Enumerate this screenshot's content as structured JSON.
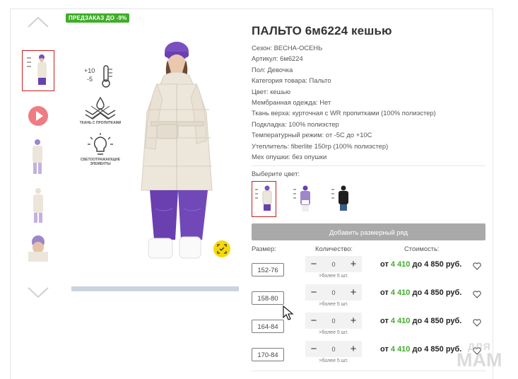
{
  "badge": "ПРЕДЗАКАЗ ДО -9%",
  "product": {
    "title": "ПАЛЬТО 6м6224 кешью",
    "properties": [
      "Сезон: ВЕСНА-ОСЕНЬ",
      "Артикул: 6м6224",
      "Пол: Девочка",
      "Категория товара: Пальто",
      "Цвет: кешью",
      "Мембранная одежда: Нет",
      "Ткань верха: курточная с WR пропитками (100% полиэстер)",
      "Подкладка: 100% полиэстер",
      "Температурный режим: от -5С до +10С",
      "Утеплитель: fiberlite 150гр (100% полиэстер)",
      "Мех опушки: без опушки"
    ]
  },
  "features": {
    "temp_top": "+10",
    "temp_bottom": "-5",
    "fabric_caption": "ТКАНЬ С ПРОПИТКАМИ",
    "reflect_caption": "СВЕТООТРАЖАЮЩИЕ ЭЛЕМЕНТЫ"
  },
  "colors": {
    "label": "Выберите цвет:",
    "swatches": [
      {
        "name": "кешью",
        "coat": "#ece5da",
        "pants": "#6a3fb0"
      },
      {
        "name": "лаванда",
        "coat": "#9d86c9",
        "pants": "#ffffff"
      },
      {
        "name": "черный",
        "coat": "#1e1e1e",
        "pants": "#3b5b8a"
      }
    ]
  },
  "add_size_button": "Добавить размерный ряд",
  "table": {
    "size_header": "Размер:",
    "qty_header": "Количество:",
    "price_header": "Стоимость:",
    "rows": [
      {
        "size": "152-76",
        "qty": "0",
        "note": ">более 5 шт.",
        "price_prefix": "от ",
        "price_from": "4 410",
        "price_suffix": " до 4 850 руб."
      },
      {
        "size": "158-80",
        "qty": "0",
        "note": ">более 5 шт.",
        "price_prefix": "от ",
        "price_from": "4 410",
        "price_suffix": " до 4 850 руб."
      },
      {
        "size": "164-84",
        "qty": "0",
        "note": ">более 5 шт.",
        "price_prefix": "от ",
        "price_from": "4 410",
        "price_suffix": " до 4 850 руб."
      },
      {
        "size": "170-84",
        "qty": "0",
        "note": ">более 5 шт.",
        "price_prefix": "от ",
        "price_from": "4 410",
        "price_suffix": " до 4 850 руб."
      }
    ]
  },
  "qty_minus": "−",
  "qty_plus": "+",
  "watermark": {
    "top": "ДЛЯ",
    "bottom": "МАМ"
  },
  "accent_colors": {
    "badge_green": "#3fae29",
    "active_border": "#c81e1e",
    "zoom_yellow": "#f5d90a",
    "video_pink": "#ef7b83"
  }
}
